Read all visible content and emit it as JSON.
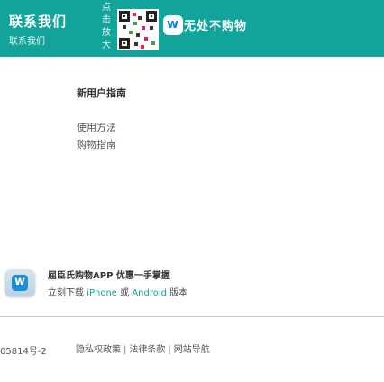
{
  "header": {
    "contact_title": "联系我们",
    "contact_sub": "联系我们",
    "qr_hint_chars": [
      "点",
      "击",
      "放",
      "大"
    ],
    "app_logo_letter": "w",
    "slogan": "无处不购物"
  },
  "guide": {
    "title": "新用户指南",
    "links": [
      "使用方法",
      "购物指南"
    ]
  },
  "app_promo": {
    "icon_letter": "w",
    "title": "屈臣氏购物APP 优惠一手掌握",
    "download_prefix": "立刻下载",
    "iphone": "iPhone",
    "or_text": "或",
    "android": "Android",
    "suffix": "版本"
  },
  "footer": {
    "icp": "05814号-2",
    "links": [
      "隐私权政策",
      "法律条款",
      "网站导航"
    ],
    "separator": "|"
  },
  "colors": {
    "topbar": "#12a39a",
    "link": "#12a39a"
  }
}
